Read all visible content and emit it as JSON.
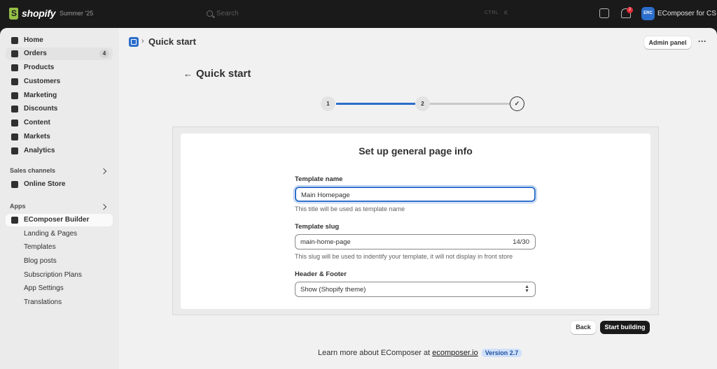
{
  "topbar": {
    "brand": "shopify",
    "edition": "Summer '25",
    "search_placeholder": "Search",
    "shortcut_key": "CTRL",
    "shortcut_key2": "K",
    "notification_count": "2",
    "avatar_initials": "ERC",
    "store_name": "EComposer for CS"
  },
  "sidebar": {
    "items": [
      {
        "label": "Home",
        "icon": "home-icon"
      },
      {
        "label": "Orders",
        "icon": "orders-icon",
        "badge": "4"
      },
      {
        "label": "Products",
        "icon": "tag-icon"
      },
      {
        "label": "Customers",
        "icon": "person-icon"
      },
      {
        "label": "Marketing",
        "icon": "target-icon"
      },
      {
        "label": "Discounts",
        "icon": "discount-icon"
      },
      {
        "label": "Content",
        "icon": "content-icon"
      },
      {
        "label": "Markets",
        "icon": "globe-icon"
      },
      {
        "label": "Analytics",
        "icon": "bar-chart-icon"
      }
    ],
    "sales_channels_label": "Sales channels",
    "online_store_label": "Online Store",
    "apps_label": "Apps",
    "app_name": "EComposer Builder",
    "app_sub_items": [
      "Landing & Pages",
      "Templates",
      "Blog posts",
      "Subscription Plans",
      "App Settings",
      "Translations"
    ]
  },
  "header": {
    "breadcrumb_separator": "›",
    "title": "Quick start",
    "admin_panel_label": "Admin panel",
    "more_label": "···"
  },
  "page": {
    "back_arrow": "←",
    "title": "Quick start",
    "steps": [
      "1",
      "2"
    ],
    "step_done_glyph": "✓",
    "progress_fraction": 0.5
  },
  "form": {
    "title": "Set up general page info",
    "template_name_label": "Template name",
    "template_name_value": "Main Homepage",
    "template_name_help": "This title will be used as template name",
    "template_slug_label": "Template slug",
    "template_slug_value": "main-home-page",
    "template_slug_count": "14/30",
    "template_slug_help": "This slug will be used to indentify your template, it will not display in front store",
    "header_footer_label": "Header & Footer",
    "header_footer_value": "Show (Shopify theme)"
  },
  "actions": {
    "back_label": "Back",
    "start_label": "Start building"
  },
  "footer": {
    "text": "Learn more about EComposer at",
    "link_text": "ecomposer.io",
    "version": "Version 2.7"
  },
  "colors": {
    "accent": "#2c6ecb",
    "brand": "#95bf47",
    "topbar": "#1a1a1a"
  }
}
